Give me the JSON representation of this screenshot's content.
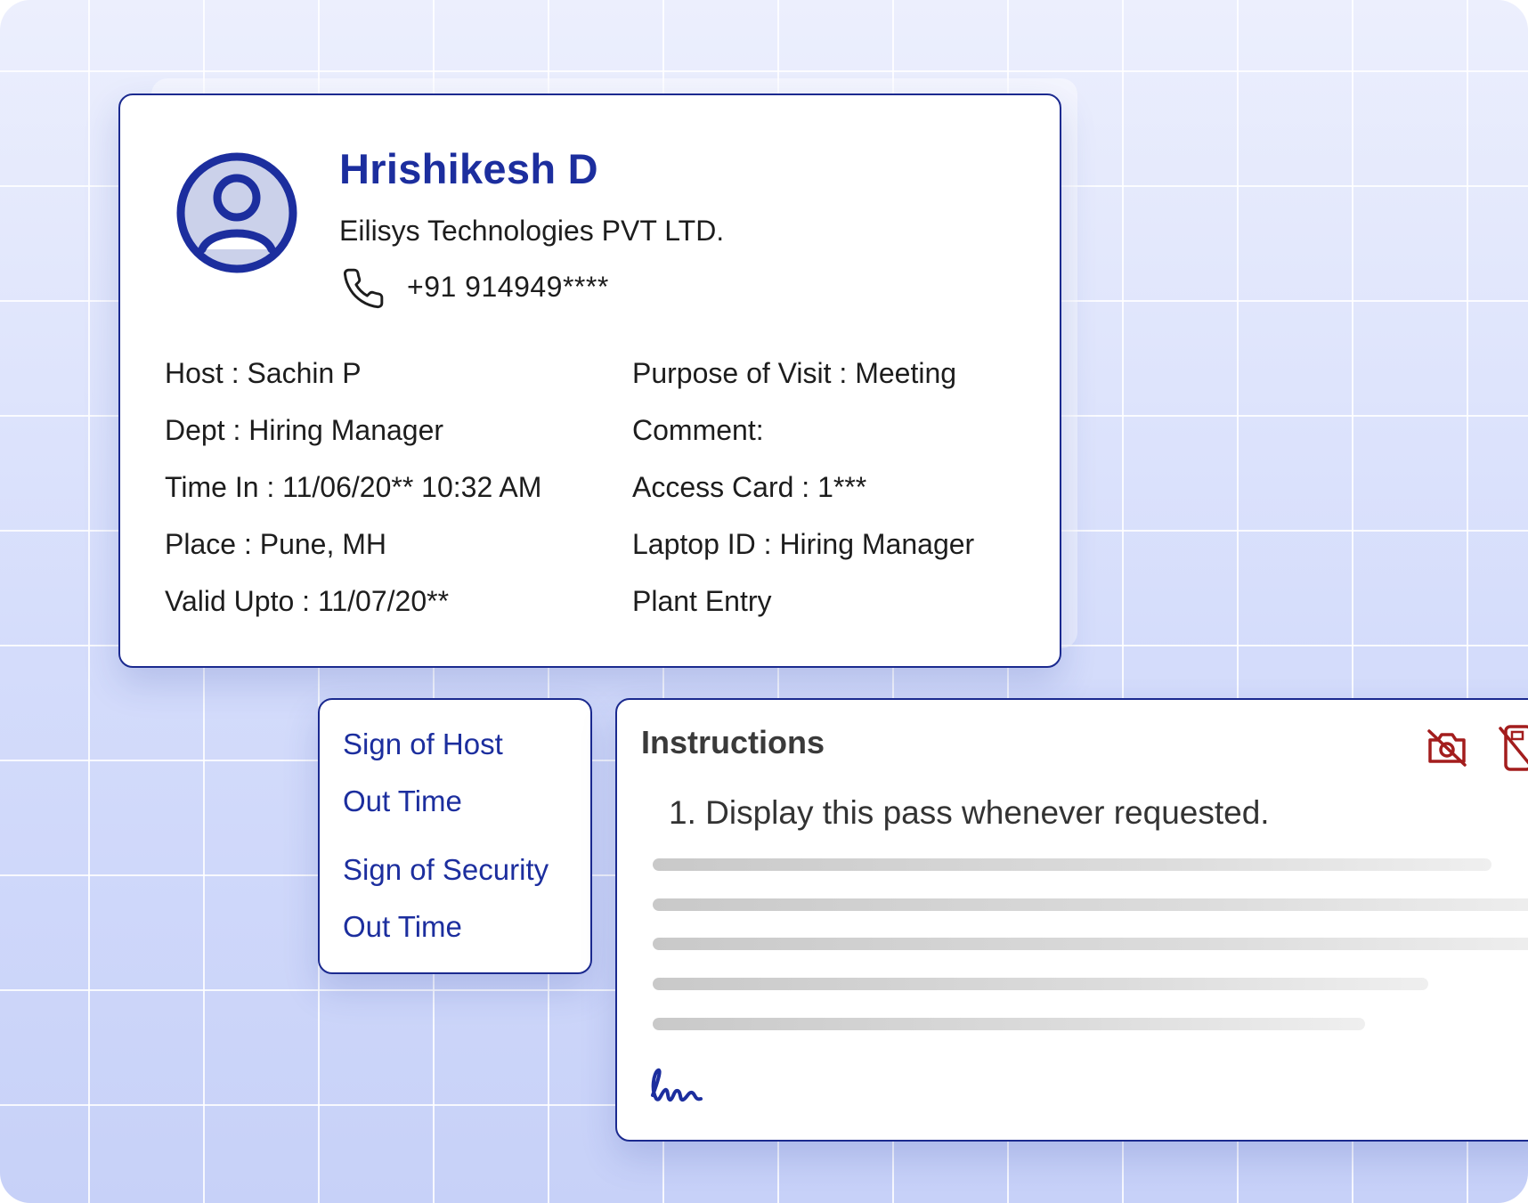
{
  "visitor": {
    "name": "Hrishikesh D",
    "company": "Eilisys Technologies PVT LTD.",
    "phone": "+91 914949****",
    "avatar_icon": "user-avatar-icon",
    "phone_icon": "phone-icon"
  },
  "details": {
    "left": [
      "Host : Sachin P",
      "Dept : Hiring Manager",
      "Time In : 11/06/20** 10:32 AM",
      "Place : Pune, MH",
      "Valid Upto : 11/07/20**"
    ],
    "right": [
      "Purpose of Visit : Meeting",
      "Comment:",
      "Access Card : 1***",
      "Laptop ID : Hiring Manager",
      "Plant Entry"
    ]
  },
  "signatures": {
    "host_sign": "Sign of Host",
    "host_out": "Out Time",
    "security_sign": "Sign of Security",
    "security_out": "Out Time"
  },
  "instructions": {
    "title": "Instructions",
    "item_1": "1.  Display this pass whenever requested.",
    "icons": [
      "no-camera-icon",
      "no-phone-icon",
      "signature-icon"
    ]
  },
  "colors": {
    "brand_blue": "#1c2e9e",
    "border_blue": "#1b2a8f",
    "warning_red": "#a31d1d"
  }
}
